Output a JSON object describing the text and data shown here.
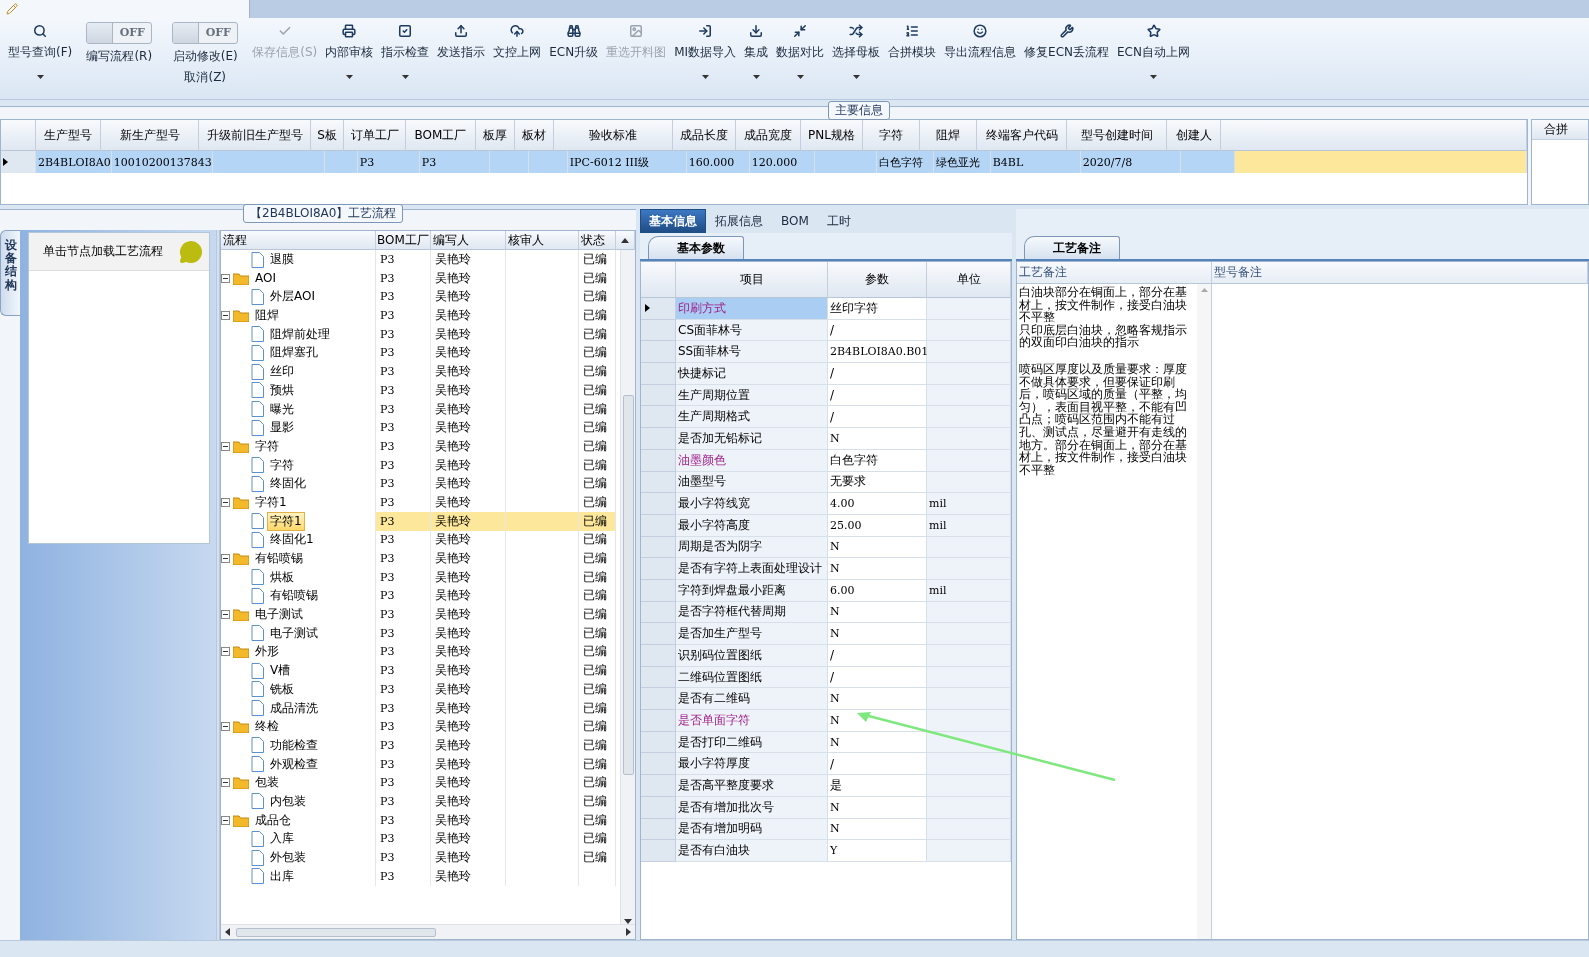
{
  "toolbar": {
    "items": [
      {
        "kind": "button",
        "label": "型号查询(F)",
        "dropdown": true,
        "disabled": false
      },
      {
        "kind": "toggle",
        "label": "编写流程(R)",
        "state_text": "OFF",
        "on": false
      },
      {
        "kind": "toggle",
        "label": "启动修改(E)",
        "label2": "取消(Z)",
        "state_text": "OFF",
        "on": false
      },
      {
        "kind": "button",
        "label": "保存信息(S)",
        "dropdown": false,
        "disabled": true
      },
      {
        "kind": "button",
        "label": "内部审核",
        "dropdown": true,
        "disabled": false
      },
      {
        "kind": "button",
        "label": "指示检查",
        "dropdown": true,
        "disabled": false
      },
      {
        "kind": "button",
        "label": "发送指示",
        "dropdown": false,
        "disabled": false
      },
      {
        "kind": "button",
        "label": "文控上网",
        "dropdown": false,
        "disabled": false
      },
      {
        "kind": "button",
        "label": "ECN升级",
        "dropdown": false,
        "disabled": false
      },
      {
        "kind": "button",
        "label": "重选开料图",
        "dropdown": false,
        "disabled": true
      },
      {
        "kind": "button",
        "label": "MI数据导入",
        "dropdown": true,
        "disabled": false
      },
      {
        "kind": "button",
        "label": "集成",
        "dropdown": true,
        "disabled": false
      },
      {
        "kind": "button",
        "label": "数据对比",
        "dropdown": true,
        "disabled": false
      },
      {
        "kind": "button",
        "label": "选择母板",
        "dropdown": true,
        "disabled": false
      },
      {
        "kind": "button",
        "label": "合拼模块",
        "dropdown": false,
        "disabled": false
      },
      {
        "kind": "button",
        "label": "导出流程信息",
        "dropdown": false,
        "disabled": false
      },
      {
        "kind": "button",
        "label": "修复ECN丢流程",
        "dropdown": false,
        "disabled": false
      },
      {
        "kind": "button",
        "label": "ECN自动上网",
        "dropdown": true,
        "disabled": false
      }
    ]
  },
  "main_info": {
    "title": "主要信息",
    "columns": [
      "生产型号",
      "新生产型号",
      "升级前旧生产型号",
      "S板",
      "订单工厂",
      "BOM工厂",
      "板厚",
      "板材",
      "验收标准",
      "成品长度",
      "成品宽度",
      "PNL规格",
      "字符",
      "阻焊",
      "终端客户代码",
      "型号创建时间",
      "创建人"
    ],
    "rows": [
      {
        "selected": true,
        "cells": [
          "2B4BLOI8A0",
          "10010200137843",
          "",
          "",
          "P3",
          "P3",
          "",
          "",
          "IPC-6012 III级",
          "160.000",
          "120.000",
          "",
          "白色字符",
          "绿色亚光",
          "B4BL",
          "2020/7/8",
          ""
        ]
      }
    ],
    "side_panel": {
      "title": "合拼"
    }
  },
  "process": {
    "title": "【2B4BLOI8A0】工艺流程",
    "side_tab": "设备结构",
    "hint": "单击节点加载工艺流程",
    "columns": [
      "流程",
      "BOM工厂",
      "编写人",
      "核审人",
      "状态"
    ],
    "nodes": [
      {
        "children": [
          {
            "label": "退膜",
            "bom": "P3",
            "writer": "吴艳玲",
            "status": "已编",
            "selected": false
          }
        ]
      },
      {
        "label": "AOI",
        "bom": "P3",
        "writer": "吴艳玲",
        "status": "已编",
        "selected": false,
        "expanded": true,
        "children": [
          {
            "label": "外层AOI",
            "bom": "P3",
            "writer": "吴艳玲",
            "status": "已编",
            "selected": false
          }
        ]
      },
      {
        "label": "阻焊",
        "bom": "P3",
        "writer": "吴艳玲",
        "status": "已编",
        "selected": false,
        "expanded": true,
        "children": [
          {
            "label": "阻焊前处理",
            "bom": "P3",
            "writer": "吴艳玲",
            "status": "已编",
            "selected": false
          },
          {
            "label": "阻焊塞孔",
            "bom": "P3",
            "writer": "吴艳玲",
            "status": "已编",
            "selected": false
          },
          {
            "label": "丝印",
            "bom": "P3",
            "writer": "吴艳玲",
            "status": "已编",
            "selected": false
          },
          {
            "label": "预烘",
            "bom": "P3",
            "writer": "吴艳玲",
            "status": "已编",
            "selected": false
          },
          {
            "label": "曝光",
            "bom": "P3",
            "writer": "吴艳玲",
            "status": "已编",
            "selected": false
          },
          {
            "label": "显影",
            "bom": "P3",
            "writer": "吴艳玲",
            "status": "已编",
            "selected": false
          }
        ]
      },
      {
        "label": "字符",
        "bom": "P3",
        "writer": "吴艳玲",
        "status": "已编",
        "selected": false,
        "expanded": true,
        "children": [
          {
            "label": "字符",
            "bom": "P3",
            "writer": "吴艳玲",
            "status": "已编",
            "selected": false
          },
          {
            "label": "终固化",
            "bom": "P3",
            "writer": "吴艳玲",
            "status": "已编",
            "selected": false
          }
        ]
      },
      {
        "label": "字符1",
        "bom": "P3",
        "writer": "吴艳玲",
        "status": "已编",
        "selected": false,
        "expanded": true,
        "children": [
          {
            "label": "字符1",
            "bom": "P3",
            "writer": "吴艳玲",
            "status": "已编",
            "selected": true
          },
          {
            "label": "终固化1",
            "bom": "P3",
            "writer": "吴艳玲",
            "status": "已编",
            "selected": false
          }
        ]
      },
      {
        "label": "有铅喷锡",
        "bom": "P3",
        "writer": "吴艳玲",
        "status": "已编",
        "selected": false,
        "expanded": true,
        "children": [
          {
            "label": "烘板",
            "bom": "P3",
            "writer": "吴艳玲",
            "status": "已编",
            "selected": false
          },
          {
            "label": "有铅喷锡",
            "bom": "P3",
            "writer": "吴艳玲",
            "status": "已编",
            "selected": false
          }
        ]
      },
      {
        "label": "电子测试",
        "bom": "P3",
        "writer": "吴艳玲",
        "status": "已编",
        "selected": false,
        "expanded": true,
        "children": [
          {
            "label": "电子测试",
            "bom": "P3",
            "writer": "吴艳玲",
            "status": "已编",
            "selected": false
          }
        ]
      },
      {
        "label": "外形",
        "bom": "P3",
        "writer": "吴艳玲",
        "status": "已编",
        "selected": false,
        "expanded": true,
        "children": [
          {
            "label": "V槽",
            "bom": "P3",
            "writer": "吴艳玲",
            "status": "已编",
            "selected": false
          },
          {
            "label": "铣板",
            "bom": "P3",
            "writer": "吴艳玲",
            "status": "已编",
            "selected": false
          },
          {
            "label": "成品清洗",
            "bom": "P3",
            "writer": "吴艳玲",
            "status": "已编",
            "selected": false
          }
        ]
      },
      {
        "label": "终检",
        "bom": "P3",
        "writer": "吴艳玲",
        "status": "已编",
        "selected": false,
        "expanded": true,
        "children": [
          {
            "label": "功能检查",
            "bom": "P3",
            "writer": "吴艳玲",
            "status": "已编",
            "selected": false
          },
          {
            "label": "外观检查",
            "bom": "P3",
            "writer": "吴艳玲",
            "status": "已编",
            "selected": false
          }
        ]
      },
      {
        "label": "包装",
        "bom": "P3",
        "writer": "吴艳玲",
        "status": "已编",
        "selected": false,
        "expanded": true,
        "children": [
          {
            "label": "内包装",
            "bom": "P3",
            "writer": "吴艳玲",
            "status": "已编",
            "selected": false
          }
        ]
      },
      {
        "label": "成品仓",
        "bom": "P3",
        "writer": "吴艳玲",
        "status": "已编",
        "selected": false,
        "expanded": true,
        "children": [
          {
            "label": "入库",
            "bom": "P3",
            "writer": "吴艳玲",
            "status": "已编",
            "selected": false
          },
          {
            "label": "外包装",
            "bom": "P3",
            "writer": "吴艳玲",
            "status": "已编",
            "selected": false
          },
          {
            "label": "出库",
            "bom": "P3",
            "writer": "吴艳玲",
            "selected": false
          }
        ]
      }
    ]
  },
  "detail": {
    "tabs": [
      {
        "label": "基本信息",
        "selected": true
      },
      {
        "label": "拓展信息",
        "selected": false
      },
      {
        "label": "BOM",
        "selected": false
      },
      {
        "label": "工时",
        "selected": false
      }
    ],
    "subtab": "基本参数",
    "columns": [
      "项目",
      "参数",
      "单位"
    ],
    "rows": [
      {
        "item": "印刷方式",
        "value": "丝印字符",
        "unit": "",
        "flagged": true,
        "selected": true
      },
      {
        "item": "CS面菲林号",
        "value": "/",
        "unit": "",
        "flagged": false,
        "selected": false
      },
      {
        "item": "SS面菲林号",
        "value": "2B4BLOI8A0.B01",
        "unit": "",
        "flagged": false,
        "selected": false
      },
      {
        "item": "快捷标记",
        "value": "/",
        "unit": "",
        "flagged": false,
        "selected": false
      },
      {
        "item": "生产周期位置",
        "value": "/",
        "unit": "",
        "flagged": false,
        "selected": false
      },
      {
        "item": "生产周期格式",
        "value": "/",
        "unit": "",
        "flagged": false,
        "selected": false
      },
      {
        "item": "是否加无铅标记",
        "value": "N",
        "unit": "",
        "flagged": false,
        "selected": false
      },
      {
        "item": "油墨颜色",
        "value": "白色字符",
        "unit": "",
        "flagged": true,
        "selected": false
      },
      {
        "item": "油墨型号",
        "value": "无要求",
        "unit": "",
        "flagged": false,
        "selected": false
      },
      {
        "item": "最小字符线宽",
        "value": "4.00",
        "unit": "mil",
        "flagged": false,
        "selected": false
      },
      {
        "item": "最小字符高度",
        "value": "25.00",
        "unit": "mil",
        "flagged": false,
        "selected": false
      },
      {
        "item": "周期是否为阴字",
        "value": "N",
        "unit": "",
        "flagged": false,
        "selected": false
      },
      {
        "item": "是否有字符上表面处理设计",
        "value": "N",
        "unit": "",
        "flagged": false,
        "selected": false
      },
      {
        "item": "字符到焊盘最小距离",
        "value": "6.00",
        "unit": "mil",
        "flagged": false,
        "selected": false
      },
      {
        "item": "是否字符框代替周期",
        "value": "N",
        "unit": "",
        "flagged": false,
        "selected": false
      },
      {
        "item": "是否加生产型号",
        "value": "N",
        "unit": "",
        "flagged": false,
        "selected": false
      },
      {
        "item": "识别码位置图纸",
        "value": "/",
        "unit": "",
        "flagged": false,
        "selected": false
      },
      {
        "item": "二维码位置图纸",
        "value": "/",
        "unit": "",
        "flagged": false,
        "selected": false
      },
      {
        "item": "是否有二维码",
        "value": "N",
        "unit": "",
        "flagged": false,
        "selected": false
      },
      {
        "item": "是否单面字符",
        "value": "N",
        "unit": "",
        "flagged": true,
        "selected": false
      },
      {
        "item": "是否打印二维码",
        "value": "N",
        "unit": "",
        "flagged": false,
        "selected": false
      },
      {
        "item": "最小字符厚度",
        "value": "/",
        "unit": "",
        "flagged": false,
        "selected": false
      },
      {
        "item": "是否高平整度要求",
        "value": "是",
        "unit": "",
        "flagged": false,
        "selected": false
      },
      {
        "item": "是否有增加批次号",
        "value": "N",
        "unit": "",
        "flagged": false,
        "selected": false
      },
      {
        "item": "是否有增加明码",
        "value": "N",
        "unit": "",
        "flagged": false,
        "selected": false
      },
      {
        "item": "是否有白油块",
        "value": "Y",
        "unit": "",
        "flagged": false,
        "selected": false
      }
    ]
  },
  "remarks": {
    "tab": "工艺备注",
    "columns": [
      "工艺备注",
      "型号备注"
    ],
    "process_note": [
      [
        "白油块部分在铜面上，部分在基材上，按文件制作，接受白油块不平整",
        "只印底层白油块，忽略客规指示的双面印白油块的指示"
      ],
      [
        "喷码区厚度以及质量要求：厚度不做具体要求，但要保证印刷后，喷码区域的质量（平整，均匀），表面目视平整，不能有凹凸点；喷码区范围内不能有过孔、测试点，尽量避开有走线的地方。部分在铜面上，部分在基材上，按文件制作，接受白油块不平整"
      ]
    ]
  }
}
